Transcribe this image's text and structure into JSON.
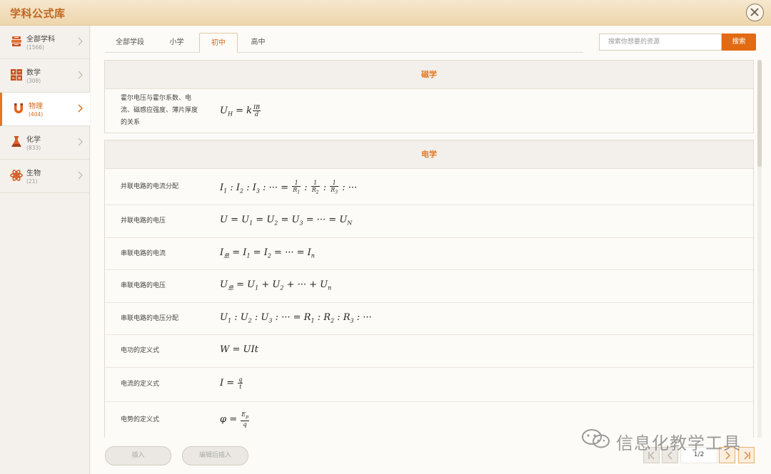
{
  "window": {
    "title": "学科公式库",
    "close_icon": "close-icon"
  },
  "sidebar": {
    "items": [
      {
        "label": "全部学科",
        "count": "(1566)",
        "icon": "books-icon",
        "active": false
      },
      {
        "label": "数学",
        "count": "(308)",
        "icon": "calculator-icon",
        "active": false
      },
      {
        "label": "物理",
        "count": "(404)",
        "icon": "magnet-icon",
        "active": true
      },
      {
        "label": "化学",
        "count": "(833)",
        "icon": "flask-icon",
        "active": false
      },
      {
        "label": "生物",
        "count": "(21)",
        "icon": "atom-icon",
        "active": false
      }
    ]
  },
  "tabs": [
    {
      "label": "全部学段",
      "active": false
    },
    {
      "label": "小学",
      "active": false
    },
    {
      "label": "初中",
      "active": true
    },
    {
      "label": "高中",
      "active": false
    }
  ],
  "search": {
    "placeholder": "搜索你想要的资源",
    "button": "搜索"
  },
  "sections": [
    {
      "title": "磁学",
      "rows": [
        {
          "name": "霍尔电压与霍尔系数、电流、磁感应强度、薄片厚度的关系",
          "formula": "U_H = k IB/d"
        }
      ]
    },
    {
      "title": "电学",
      "rows": [
        {
          "name": "并联电路的电流分配",
          "formula": "I1 : I2 : I3 : ··· = 1/R1 : 1/R2 : 1/R3 : ···"
        },
        {
          "name": "并联电路的电压",
          "formula": "U = U1 = U2 = U3 = ··· = UN"
        },
        {
          "name": "串联电路的电流",
          "formula": "I总 = I1 = I2 = ··· = In"
        },
        {
          "name": "串联电路的电压",
          "formula": "U总 = U1 + U2 + ··· + Un"
        },
        {
          "name": "串联电路的电压分配",
          "formula": "U1 : U2 : U3 : ··· = R1 : R2 : R3 : ···"
        },
        {
          "name": "电功的定义式",
          "formula": "W = UIt"
        },
        {
          "name": "电流的定义式",
          "formula": "I = q/t"
        },
        {
          "name": "电势的定义式",
          "formula": "φ = Ep/q"
        }
      ]
    }
  ],
  "bottom": {
    "insert": "插入",
    "edit_insert": "编辑后插入"
  },
  "pagination": {
    "page": "1/2"
  },
  "watermark": {
    "text": "信息化教学工具"
  },
  "colors": {
    "accent": "#e26a13",
    "section_title": "#e07a27"
  }
}
